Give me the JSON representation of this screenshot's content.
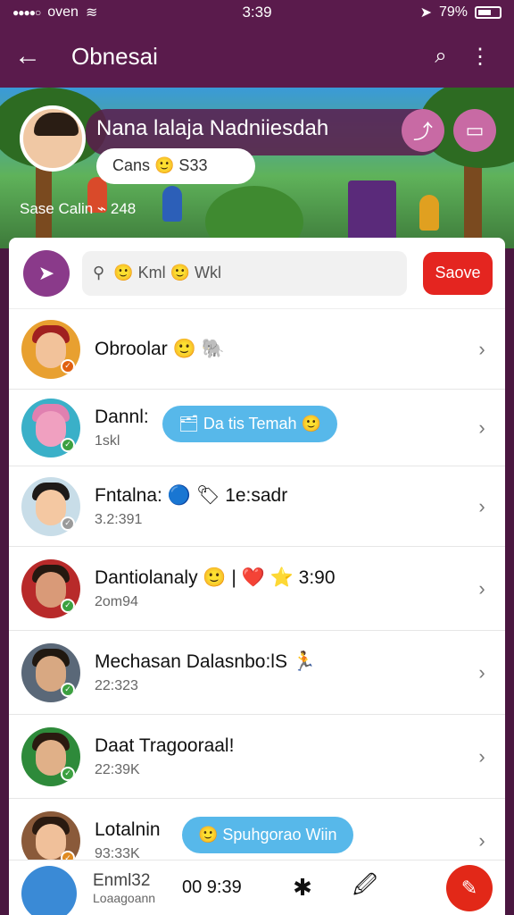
{
  "status_bar": {
    "carrier": "oven",
    "time": "3:39",
    "battery": "79%"
  },
  "app_bar": {
    "title": "Obnesai"
  },
  "banner": {
    "name": "Nana lalaja Nadniiesdah",
    "bubble": "Cans 🙂 S33",
    "subtitle": "Sase Calin ⌁ 248"
  },
  "search": {
    "placeholder": "🙂 Kml 🙂 Wkl",
    "save_label": "Saove"
  },
  "items": [
    {
      "name": "Obroolar 🙂 🐘",
      "sub": "",
      "bubble": ""
    },
    {
      "name": "Dannl:",
      "sub": "1skl",
      "bubble": "🗂 Da tis Temah 🙂"
    },
    {
      "name": "Fntalna: 🔵 🏷 1e:sadr",
      "sub": "3.2:391",
      "bubble": ""
    },
    {
      "name": "Dantiolanaly 🙂 | ❤️ ⭐ 3:90",
      "sub": "2om94",
      "bubble": ""
    },
    {
      "name": "Mechasan Dalasnbo:lS 🏃",
      "sub": "22:323",
      "bubble": ""
    },
    {
      "name": "Daat Tragooraal!",
      "sub": "22:39K",
      "bubble": ""
    },
    {
      "name": "Lotalnin",
      "sub": "93:33K",
      "bubble": "🙂 Spuhgorao Wiin"
    }
  ],
  "bottom_bar": {
    "name": "Enml32",
    "sub": "Loaagoann",
    "time": "00 9:39",
    "icon_star": "✱",
    "icon_edit": "🖉"
  }
}
